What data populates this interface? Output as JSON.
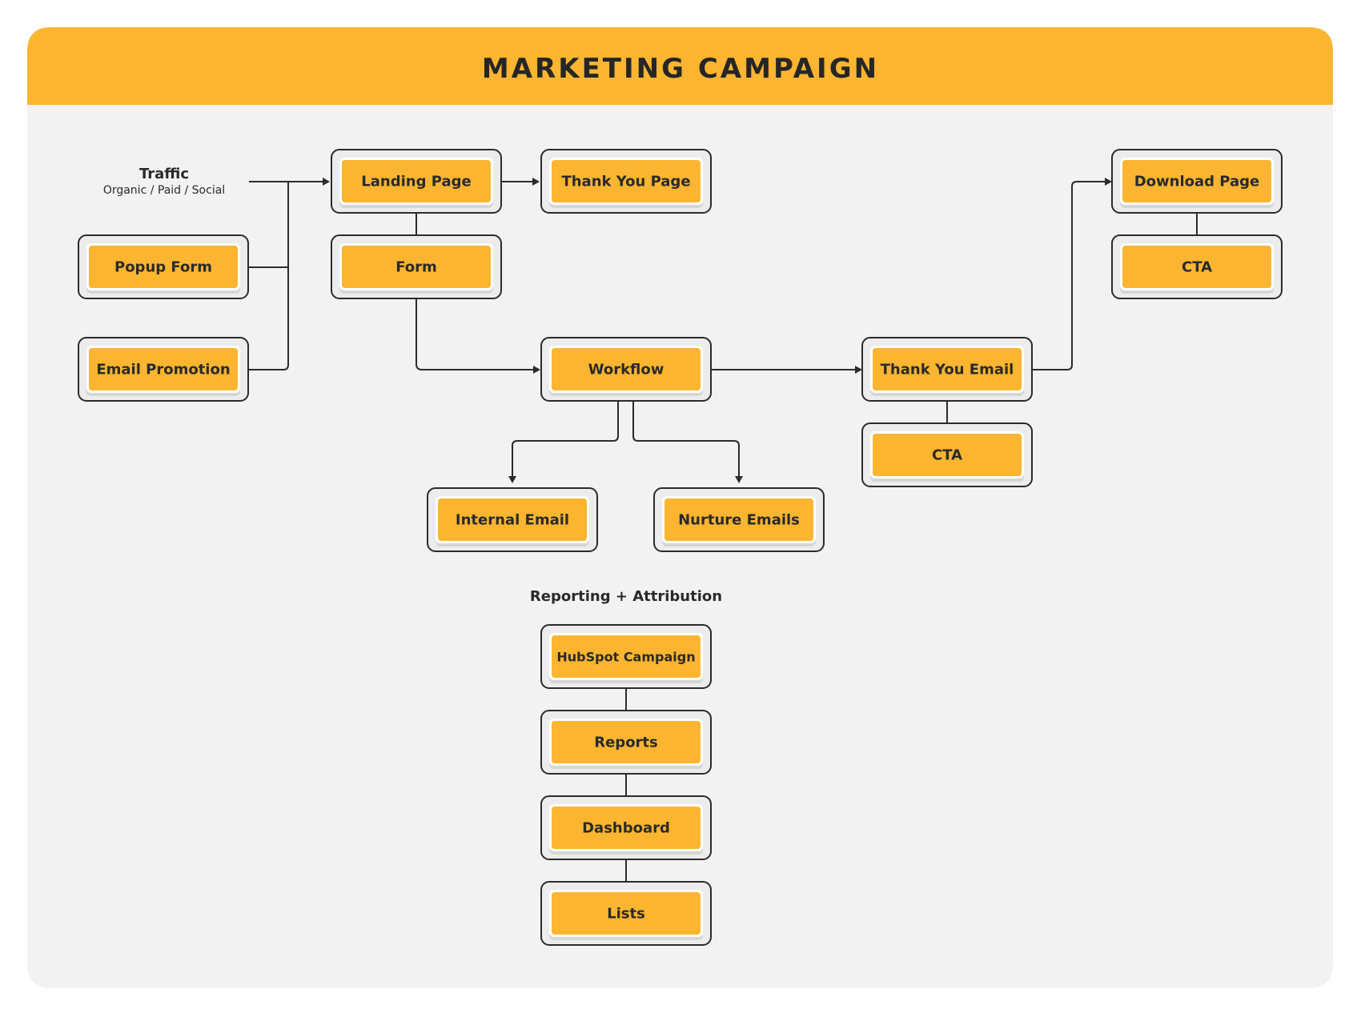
{
  "title": "MARKETING CAMPAIGN",
  "colors": {
    "accent": "#fbb530",
    "card_background": "#f2f2f2",
    "text": "#2a2a2a",
    "line": "#2b2b2b"
  },
  "traffic": {
    "title": "Traffic",
    "subtitle": "Organic / Paid / Social"
  },
  "section": {
    "reporting_label": "Reporting + Attribution"
  },
  "nodes": {
    "popup_form": "Popup Form",
    "email_promotion": "Email Promotion",
    "landing_page": "Landing Page",
    "form": "Form",
    "thank_you_page": "Thank You Page",
    "workflow": "Workflow",
    "internal_email": "Internal Email",
    "nurture_emails": "Nurture Emails",
    "thank_you_email": "Thank You Email",
    "cta_email": "CTA",
    "download_page": "Download Page",
    "cta_download": "CTA",
    "hubspot_campaign": "HubSpot Campaign",
    "reports": "Reports",
    "dashboard": "Dashboard",
    "lists": "Lists"
  },
  "edges": [
    {
      "from": "traffic",
      "to": "landing_page",
      "arrow": true
    },
    {
      "from": "popup_form",
      "to": "landing_page",
      "arrow": true
    },
    {
      "from": "email_promotion",
      "to": "landing_page",
      "arrow": true
    },
    {
      "from": "landing_page",
      "to": "thank_you_page",
      "arrow": true
    },
    {
      "from": "landing_page",
      "to": "form",
      "arrow": false
    },
    {
      "from": "form",
      "to": "workflow",
      "arrow": true
    },
    {
      "from": "workflow",
      "to": "internal_email",
      "arrow": true
    },
    {
      "from": "workflow",
      "to": "nurture_emails",
      "arrow": true
    },
    {
      "from": "workflow",
      "to": "thank_you_email",
      "arrow": true
    },
    {
      "from": "thank_you_email",
      "to": "cta_email",
      "arrow": false
    },
    {
      "from": "thank_you_email",
      "to": "download_page",
      "arrow": true
    },
    {
      "from": "download_page",
      "to": "cta_download",
      "arrow": false
    },
    {
      "from": "hubspot_campaign",
      "to": "reports",
      "arrow": false
    },
    {
      "from": "reports",
      "to": "dashboard",
      "arrow": false
    },
    {
      "from": "dashboard",
      "to": "lists",
      "arrow": false
    }
  ]
}
